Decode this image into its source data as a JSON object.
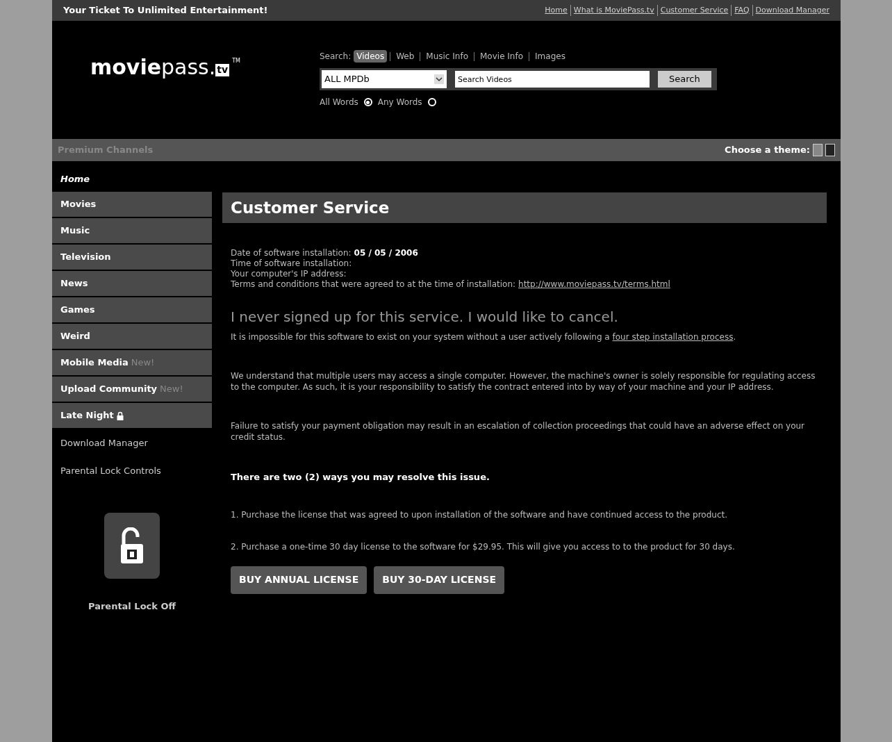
{
  "top_bar": {
    "tagline": "Your Ticket To Unlimited Entertainment!",
    "links": [
      "Home",
      "What is MoviePass.tv",
      "Customer Service",
      "FAQ",
      "Download Manager"
    ]
  },
  "logo": {
    "bold": "movie",
    "light": "pass.",
    "tld": "tv",
    "mark": "TM"
  },
  "search": {
    "label": "Search:",
    "tabs": [
      {
        "label": "Videos",
        "selected": true
      },
      {
        "label": "Web",
        "selected": false
      },
      {
        "label": "Music Info",
        "selected": false
      },
      {
        "label": "Movie Info",
        "selected": false
      },
      {
        "label": "Images",
        "selected": false
      }
    ],
    "scope": "ALL MPDb",
    "placeholder": "Search Videos",
    "button": "Search",
    "options": [
      {
        "label": "All Words",
        "selected": true
      },
      {
        "label": "Any Words",
        "selected": false
      }
    ]
  },
  "channel_bar": {
    "title": "Premium Channels",
    "theme_label": "Choose a theme:"
  },
  "sidebar": {
    "items": [
      {
        "label": "Home",
        "kind": "home"
      },
      {
        "label": "Movies",
        "kind": "channel"
      },
      {
        "label": "Music",
        "kind": "channel"
      },
      {
        "label": "Television",
        "kind": "channel"
      },
      {
        "label": "News",
        "kind": "channel"
      },
      {
        "label": "Games",
        "kind": "channel"
      },
      {
        "label": "Weird",
        "kind": "channel"
      },
      {
        "label": "Mobile Media",
        "kind": "channel",
        "badge": "New!"
      },
      {
        "label": "Upload Community",
        "kind": "channel",
        "badge": "New!"
      },
      {
        "label": "Late Night",
        "kind": "channel",
        "locked": true
      },
      {
        "label": "Download Manager",
        "kind": "tool"
      },
      {
        "label": "Parental Lock Controls",
        "kind": "tool"
      }
    ],
    "lock_status": "Parental Lock Off"
  },
  "content": {
    "title": "Customer Service",
    "details": [
      {
        "label": "Date of software installation:",
        "value": "05 / 05 / 2006"
      },
      {
        "label": "Time of software installation:"
      },
      {
        "label": "Your computer's IP address:"
      },
      {
        "label": "Terms and conditions that were agreed to at the time of installation:",
        "link": "http://www.moviepass.tv/terms.html"
      }
    ],
    "heading": "I never signed up for this service. I would like to cancel.",
    "intro": "It is impossible for this software to exist on your system without a user actively following a ",
    "intro_link": "four step installation process",
    "intro_end": ".",
    "paragraphs": [
      "We understand that multiple users may access a single computer. However, the machine's owner is solely responsible for regulating access to the computer. As such, it is your responsibility to satisfy the contract entered into by way of your machine and your IP address.",
      "Failure to satisfy your payment obligation may result in an escalation of collection proceedings that could have an adverse effect on your credit status."
    ],
    "resolve": "There are two (2) ways you may resolve this issue.",
    "options": [
      "1. Purchase the license that was agreed to upon installation of the software and have continued access to the product.",
      "2. Purchase a one-time 30 day license to the software for $29.95. This will give you access to to the product for 30 days."
    ],
    "buttons": [
      "BUY ANNUAL LICENSE",
      "BUY 30-DAY LICENSE"
    ]
  }
}
